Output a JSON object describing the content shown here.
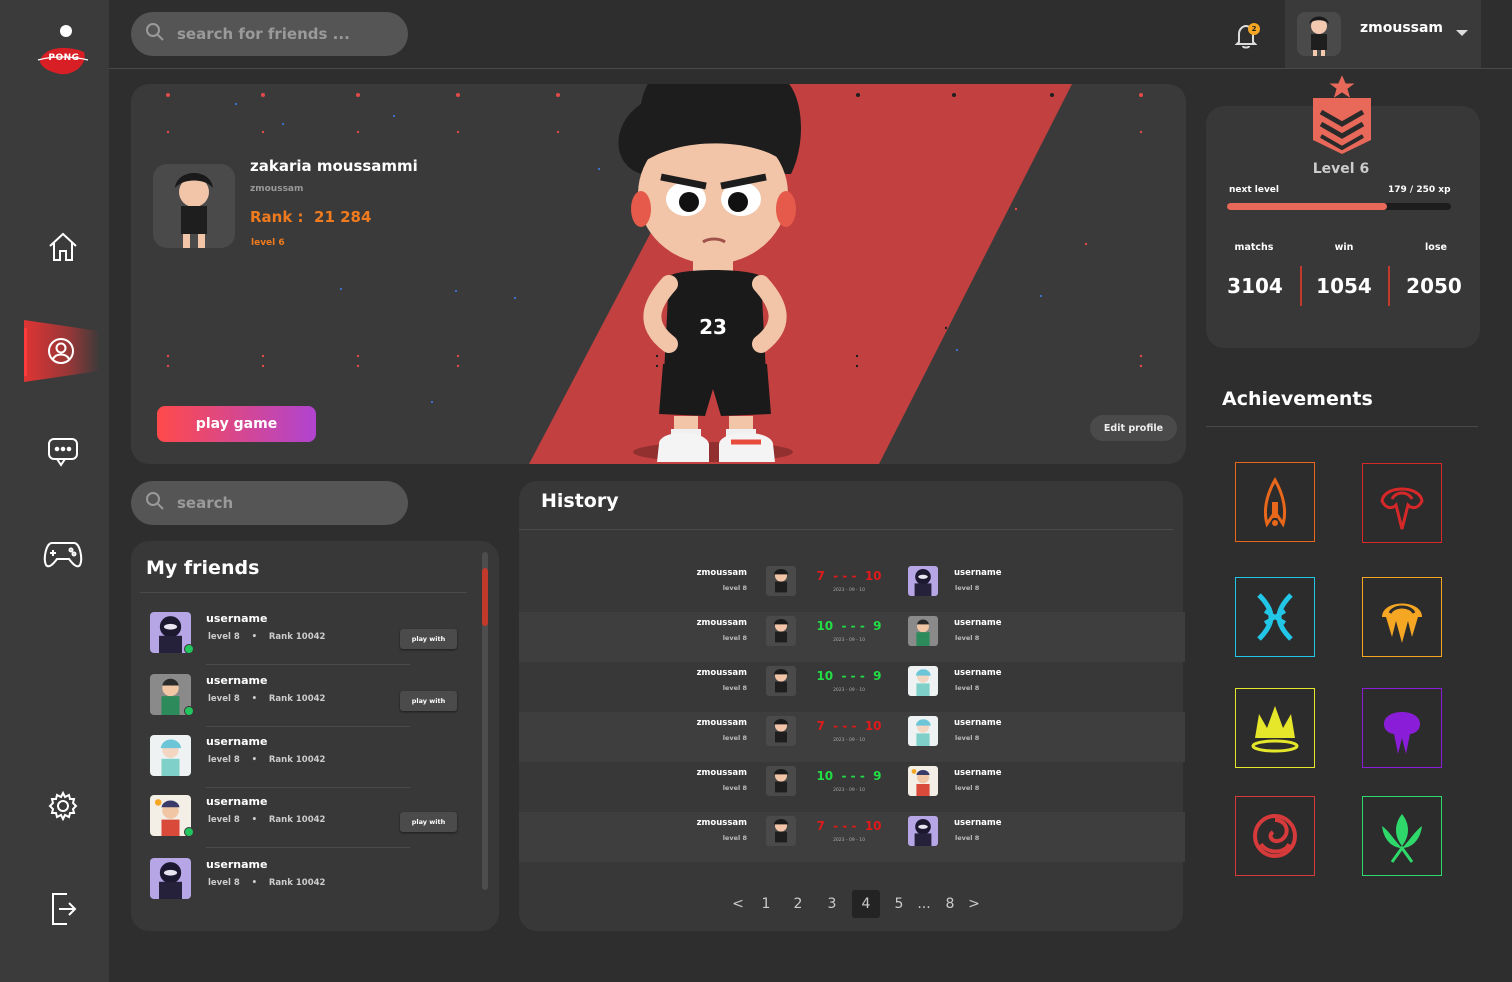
{
  "app": {
    "logo_text": "PONG"
  },
  "search_top": {
    "placeholder": "search for friends ..."
  },
  "search_friends": {
    "placeholder": "search"
  },
  "notifications": {
    "count": "2"
  },
  "user": {
    "name": "zmoussam"
  },
  "profile": {
    "full_name": "zakaria moussammi",
    "login": "zmoussam",
    "rank_label": "Rank :",
    "rank_value": "21 284",
    "level": "level 6",
    "play_button": "play game",
    "edit_button": "Edit profile"
  },
  "level_card": {
    "title": "Level 6",
    "next_level_label": "next level",
    "xp_text": "179 / 250 xp",
    "xp_progress": 0.716,
    "stats": [
      {
        "label": "matchs",
        "value": "3104"
      },
      {
        "label": "win",
        "value": "1054"
      },
      {
        "label": "lose",
        "value": "2050"
      }
    ]
  },
  "achievements": {
    "title": "Achievements",
    "items": [
      {
        "icon": "spear-icon",
        "color": "#e8671a"
      },
      {
        "icon": "wing-icon",
        "color": "#d62828"
      },
      {
        "icon": "claws-icon",
        "color": "#22c6e6"
      },
      {
        "icon": "jellyfish-icon",
        "color": "#f5a623"
      },
      {
        "icon": "crown-icon",
        "color": "#e6e62a"
      },
      {
        "icon": "purple-drop-icon",
        "color": "#8a1ed8"
      },
      {
        "icon": "spiral-icon",
        "color": "#d63a3a"
      },
      {
        "icon": "lotus-icon",
        "color": "#2ed86a"
      }
    ]
  },
  "friends": {
    "title": "My friends",
    "items": [
      {
        "name": "username",
        "level": "level 8",
        "rank_label": "Rank",
        "rank": "10042",
        "online": true,
        "button": "play with",
        "avatar": "ninja"
      },
      {
        "name": "username",
        "level": "level 8",
        "rank_label": "Rank",
        "rank": "10042",
        "online": true,
        "button": "play with",
        "avatar": "boy"
      },
      {
        "name": "username",
        "level": "level 8",
        "rank_label": "Rank",
        "rank": "10042",
        "online": false,
        "button": "",
        "avatar": "blue"
      },
      {
        "name": "username",
        "level": "level 8",
        "rank_label": "Rank",
        "rank": "10042",
        "online": true,
        "button": "play with",
        "avatar": "fox"
      },
      {
        "name": "username",
        "level": "level 8",
        "rank_label": "Rank",
        "rank": "10042",
        "online": false,
        "button": "",
        "avatar": "ninja"
      }
    ]
  },
  "history": {
    "title": "History",
    "matches": [
      {
        "player": "zmoussam",
        "player_level": "level 8",
        "score_a": "7",
        "score_b": "10",
        "result": "lose",
        "date": "2023 - 09 - 10",
        "opponent": "username",
        "opponent_level": "level 8",
        "opp_avatar": "ninja"
      },
      {
        "player": "zmoussam",
        "player_level": "level 8",
        "score_a": "10",
        "score_b": "9",
        "result": "win",
        "date": "2023 - 09 - 10",
        "opponent": "username",
        "opponent_level": "level 8",
        "opp_avatar": "boy"
      },
      {
        "player": "zmoussam",
        "player_level": "level 8",
        "score_a": "10",
        "score_b": "9",
        "result": "win",
        "date": "2023 - 09 - 10",
        "opponent": "username",
        "opponent_level": "level 8",
        "opp_avatar": "blue"
      },
      {
        "player": "zmoussam",
        "player_level": "level 8",
        "score_a": "7",
        "score_b": "10",
        "result": "lose",
        "date": "2023 - 09 - 10",
        "opponent": "username",
        "opponent_level": "level 8",
        "opp_avatar": "blue"
      },
      {
        "player": "zmoussam",
        "player_level": "level 8",
        "score_a": "10",
        "score_b": "9",
        "result": "win",
        "date": "2023 - 09 - 10",
        "opponent": "username",
        "opponent_level": "level 8",
        "opp_avatar": "fox"
      },
      {
        "player": "zmoussam",
        "player_level": "level 8",
        "score_a": "7",
        "score_b": "10",
        "result": "lose",
        "date": "2023 - 09 - 10",
        "opponent": "username",
        "opponent_level": "level 8",
        "opp_avatar": "ninja"
      }
    ],
    "pagination": [
      "<",
      "1",
      "2",
      "3",
      "4",
      "5",
      "...",
      "8",
      ">"
    ],
    "current_page": "4"
  },
  "colors": {
    "accent": "#e03434",
    "orange": "#f07b1e",
    "win": "#22dd44",
    "lose": "#e01a1a"
  }
}
